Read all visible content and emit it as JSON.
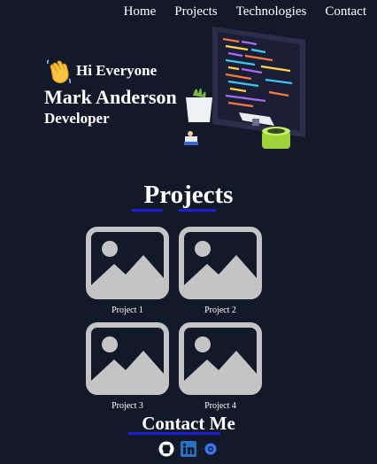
{
  "nav": {
    "items": [
      "Home",
      "Projects",
      "Technologies",
      "Contact"
    ]
  },
  "hero": {
    "greeting": "Hi Everyone",
    "name": "Mark Anderson",
    "role": "Developer"
  },
  "projects": {
    "title": "Projects",
    "items": [
      {
        "label": "Project 1"
      },
      {
        "label": "Project 2"
      },
      {
        "label": "Project 3"
      },
      {
        "label": "Project 4"
      }
    ]
  },
  "contact": {
    "title": "Contact Me",
    "icons": [
      "github-icon",
      "linkedin-icon",
      "signal-icon"
    ]
  },
  "colors": {
    "background": "#121a2a",
    "accent": "#1f1fd9",
    "placeholder": "#c4c4c4"
  }
}
